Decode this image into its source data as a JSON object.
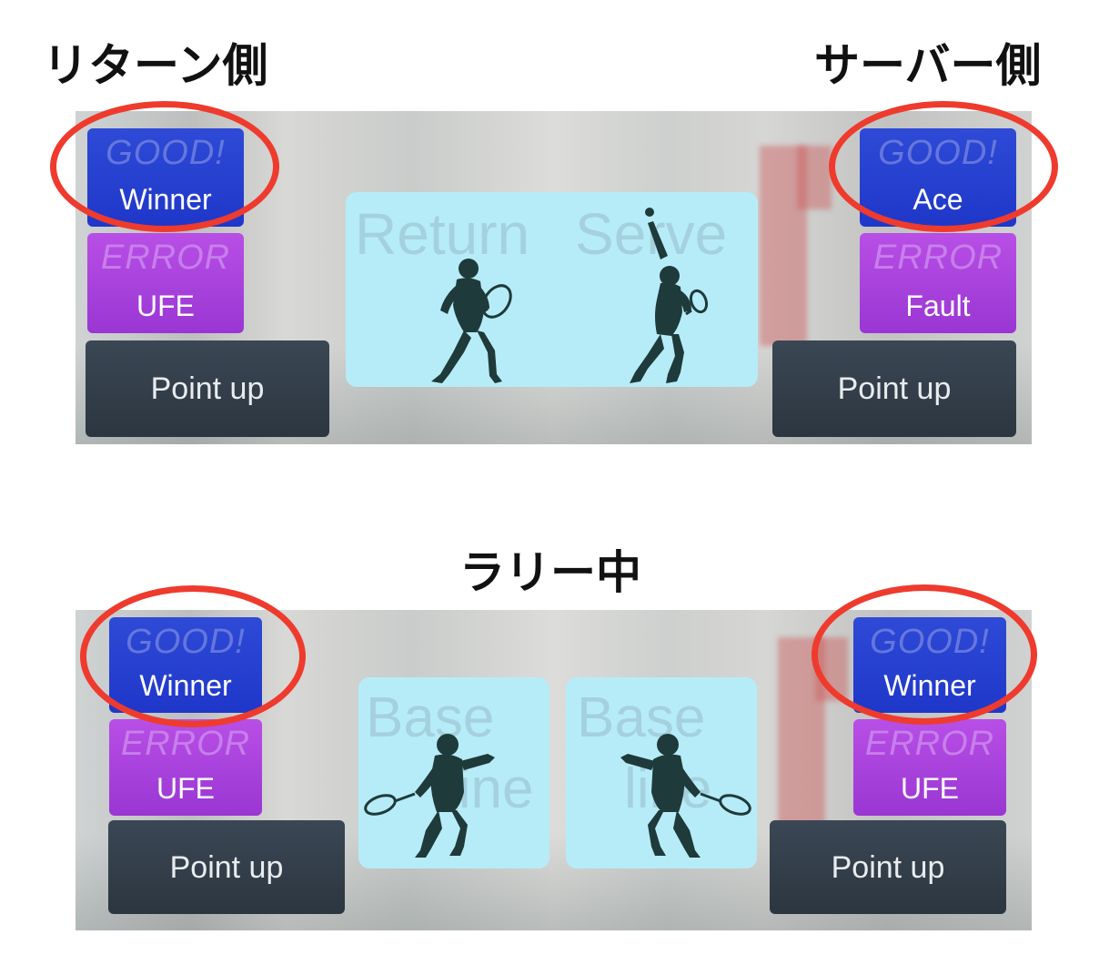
{
  "captions": {
    "return_side": "リターン側",
    "server_side": "サーバー側",
    "rally": "ラリー中"
  },
  "top_panel": {
    "left": {
      "good_ghost": "GOOD!",
      "good_label": "Winner",
      "error_ghost": "ERROR",
      "error_label": "UFE",
      "point_label": "Point up"
    },
    "center": {
      "return_word": "Return",
      "serve_word": "Serve"
    },
    "right": {
      "good_ghost": "GOOD!",
      "good_label": "Ace",
      "error_ghost": "ERROR",
      "error_label": "Fault",
      "point_label": "Point up"
    }
  },
  "bottom_panel": {
    "left": {
      "good_ghost": "GOOD!",
      "good_label": "Winner",
      "error_ghost": "ERROR",
      "error_label": "UFE",
      "point_label": "Point up"
    },
    "center": {
      "left_word_1": "Base",
      "left_word_2": "line",
      "right_word_1": "Base",
      "right_word_2": "line"
    },
    "right": {
      "good_ghost": "GOOD!",
      "good_label": "Winner",
      "error_ghost": "ERROR",
      "error_label": "UFE",
      "point_label": "Point up"
    }
  },
  "colors": {
    "good_button": "#2438cf",
    "error_button": "#a63fdb",
    "point_button": "#333f4a",
    "court_bg": "#b6ecf8",
    "highlight_ring": "#ee3b2e"
  }
}
